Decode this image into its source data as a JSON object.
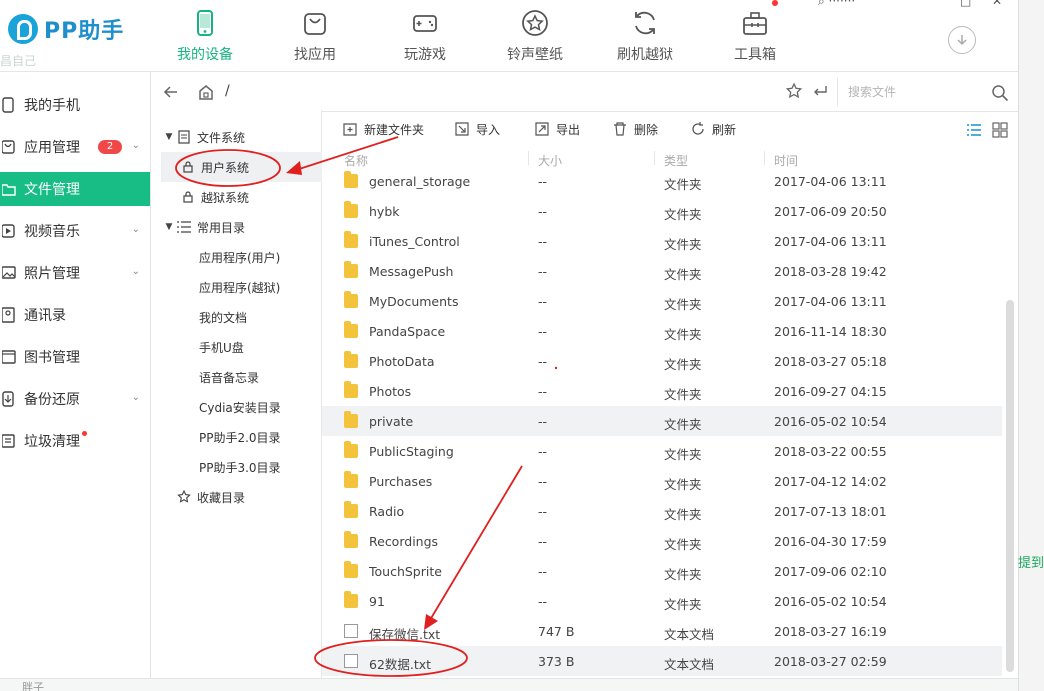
{
  "app": {
    "logo_text": "PP助手",
    "blur_text": "昌自己"
  },
  "nav": [
    {
      "label": "我的设备",
      "icon": "phone-icon",
      "active": true
    },
    {
      "label": "找应用",
      "icon": "bag-icon",
      "active": false
    },
    {
      "label": "玩游戏",
      "icon": "gamepad-icon",
      "active": false
    },
    {
      "label": "铃声壁纸",
      "icon": "star-icon",
      "active": false
    },
    {
      "label": "刷机越狱",
      "icon": "refresh-icon",
      "active": false
    },
    {
      "label": "工具箱",
      "icon": "toolbox-icon",
      "active": false
    }
  ],
  "sidebar": {
    "items": [
      {
        "label": "我的手机",
        "icon": "phone-icon"
      },
      {
        "label": "应用管理",
        "icon": "bag-icon",
        "badge": "2"
      },
      {
        "label": "文件管理",
        "icon": "folder-icon",
        "active": true
      },
      {
        "label": "视频音乐",
        "icon": "play-icon",
        "chevron": true
      },
      {
        "label": "照片管理",
        "icon": "photo-icon",
        "chevron": true
      },
      {
        "label": "通讯录",
        "icon": "contacts-icon"
      },
      {
        "label": "图书管理",
        "icon": "book-icon"
      },
      {
        "label": "备份还原",
        "icon": "backup-icon",
        "chevron": true
      },
      {
        "label": "垃圾清理",
        "icon": "trash-icon",
        "dot": true
      }
    ]
  },
  "pathbar": {
    "path": "/",
    "search_placeholder": "搜索文件"
  },
  "tree": {
    "file_system": "文件系统",
    "user_system": "用户系统",
    "jailbreak_system": "越狱系统",
    "common_dirs": "常用目录",
    "common_items": [
      "应用程序(用户)",
      "应用程序(越狱)",
      "我的文档",
      "手机U盘",
      "语音备忘录",
      "Cydia安装目录",
      "PP助手2.0目录",
      "PP助手3.0目录"
    ],
    "favorites": "收藏目录"
  },
  "toolbar": {
    "new_folder": "新建文件夹",
    "import": "导入",
    "export": "导出",
    "delete": "删除",
    "refresh": "刷新"
  },
  "list": {
    "columns": [
      "名称",
      "大小",
      "类型",
      "时间"
    ],
    "rows": [
      {
        "name": "general_storage",
        "size": "--",
        "type": "文件夹",
        "time": "2017-04-06 13:11",
        "kind": "folder"
      },
      {
        "name": "hybk",
        "size": "--",
        "type": "文件夹",
        "time": "2017-06-09 20:50",
        "kind": "folder"
      },
      {
        "name": "iTunes_Control",
        "size": "--",
        "type": "文件夹",
        "time": "2017-04-06 13:11",
        "kind": "folder"
      },
      {
        "name": "MessagePush",
        "size": "--",
        "type": "文件夹",
        "time": "2018-03-28 19:42",
        "kind": "folder"
      },
      {
        "name": "MyDocuments",
        "size": "--",
        "type": "文件夹",
        "time": "2017-04-06 13:11",
        "kind": "folder"
      },
      {
        "name": "PandaSpace",
        "size": "--",
        "type": "文件夹",
        "time": "2016-11-14 18:30",
        "kind": "folder"
      },
      {
        "name": "PhotoData",
        "size": "--",
        "type": "文件夹",
        "time": "2018-03-27 05:18",
        "kind": "folder"
      },
      {
        "name": "Photos",
        "size": "--",
        "type": "文件夹",
        "time": "2016-09-27 04:15",
        "kind": "folder"
      },
      {
        "name": "private",
        "size": "--",
        "type": "文件夹",
        "time": "2016-05-02 10:54",
        "kind": "folder"
      },
      {
        "name": "PublicStaging",
        "size": "--",
        "type": "文件夹",
        "time": "2018-03-22 00:55",
        "kind": "folder"
      },
      {
        "name": "Purchases",
        "size": "--",
        "type": "文件夹",
        "time": "2017-04-12 14:02",
        "kind": "folder"
      },
      {
        "name": "Radio",
        "size": "--",
        "type": "文件夹",
        "time": "2017-07-13 18:01",
        "kind": "folder"
      },
      {
        "name": "Recordings",
        "size": "--",
        "type": "文件夹",
        "time": "2016-04-30 17:59",
        "kind": "folder"
      },
      {
        "name": "TouchSprite",
        "size": "--",
        "type": "文件夹",
        "time": "2017-09-06 02:10",
        "kind": "folder"
      },
      {
        "name": "91",
        "size": "--",
        "type": "文件夹",
        "time": "2016-05-02 10:54",
        "kind": "folder"
      },
      {
        "name": "保存微信.txt",
        "size": "747 B",
        "type": "文本文档",
        "time": "2018-03-27 16:19",
        "kind": "doc"
      },
      {
        "name": "62数据.txt",
        "size": "373 B",
        "type": "文本文档",
        "time": "2018-03-27 02:59",
        "kind": "doc"
      }
    ]
  },
  "edge_text": "提到",
  "bottom_text": "胖子",
  "colors": {
    "accent": "#18bd85",
    "annotation": "#e02020",
    "folder": "#f3c33c"
  }
}
